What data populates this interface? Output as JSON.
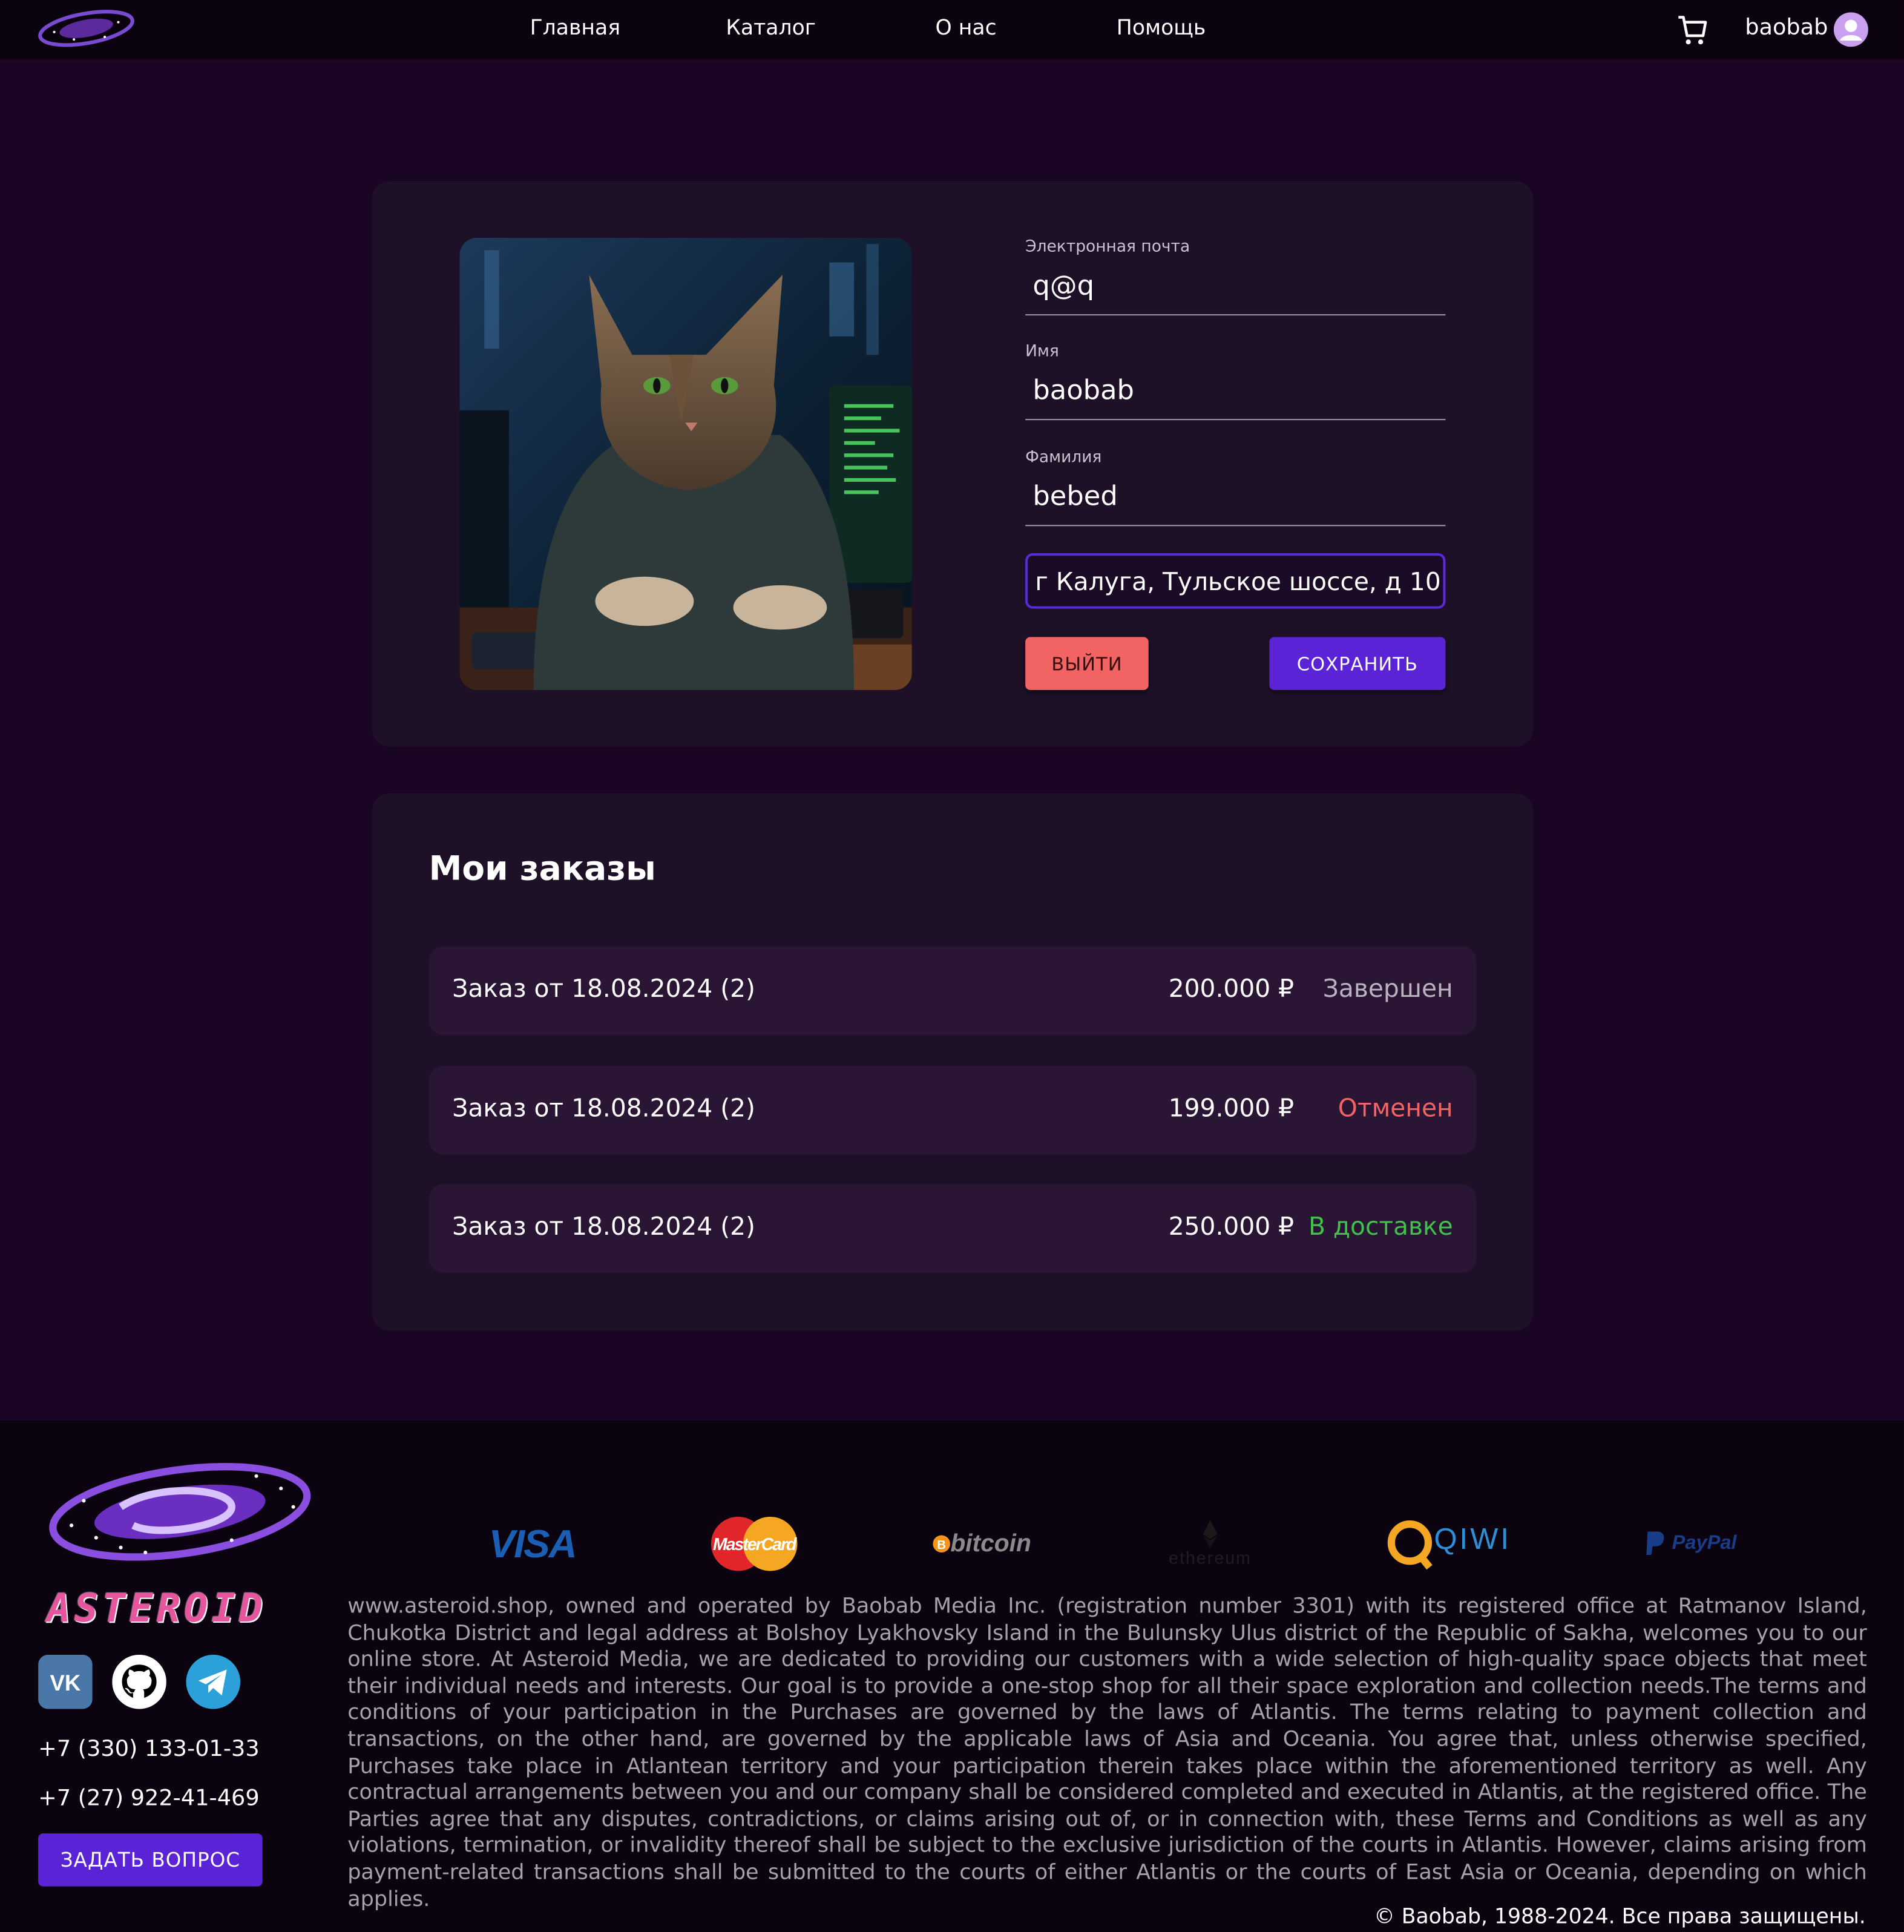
{
  "header": {
    "nav": [
      "Главная",
      "Каталог",
      "О нас",
      "Помощь"
    ],
    "username": "baobab"
  },
  "profile": {
    "email_label": "Электронная почта",
    "email_value": "q@q",
    "name_label": "Имя",
    "name_value": "baobab",
    "surname_label": "Фамилия",
    "surname_value": "bebed",
    "address_value": "г Калуга, Тульское шоссе, д 10",
    "logout_label": "ВЫЙТИ",
    "save_label": "СОХРАНИТЬ"
  },
  "orders": {
    "title": "Мои заказы",
    "items": [
      {
        "title": "Заказ от 18.08.2024 (2)",
        "price": "200.000 ₽",
        "status": "Завершен",
        "status_color": "#b9b2bf"
      },
      {
        "title": "Заказ от 18.08.2024 (2)",
        "price": "199.000 ₽",
        "status": "Отменен",
        "status_color": "#f26464"
      },
      {
        "title": "Заказ от 18.08.2024 (2)",
        "price": "250.000 ₽",
        "status": "В доставке",
        "status_color": "#3fc24a"
      }
    ]
  },
  "footer": {
    "brand": "ASTEROID",
    "phones": [
      "+7 (330) 133-01-33",
      "+7 (27) 922-41-469"
    ],
    "ask_label": "ЗАДАТЬ ВОПРОС",
    "payments": [
      "VISA",
      "MasterCard",
      "bitcoin",
      "ethereum",
      "QIWI",
      "PayPal"
    ],
    "legal": "www.asteroid.shop, owned and operated by Baobab Media Inc. (registration number 3301) with its registered office at Ratmanov Island, Chukotka District and legal address at Bolshoy Lyakhovsky Island in the Bulunsky Ulus district of the Republic of Sakha, welcomes you to our online store. At Asteroid Media, we are dedicated to providing our customers with a wide selection of high-quality space objects that meet their individual needs and interests. Our goal is to provide a one-stop shop for all their space exploration and collection needs.The terms and conditions of your participation in the Purchases are governed by the laws of Atlantis. The terms relating to payment collection and transactions, on the other hand, are governed by the applicable laws of Asia and Oceania. You agree that, unless otherwise specified, Purchases take place in Atlantean territory and your participation therein takes place within the aforementioned territory as well. Any contractual arrangements between you and our company shall be considered completed and executed in Atlantis, at the registered office. The Parties agree that any disputes, contradictions, or claims arising out of, or in connection with, these Terms and Conditions as well as any violations, termination, or invalidity thereof shall be subject to the exclusive jurisdiction of the courts in Atlantis. However, claims arising from payment-related transactions shall be submitted to the courts of either Atlantis or the courts of East Asia or Oceania, depending on which applies.",
    "copyright": "© Baobab, 1988-2024. Все права защищены."
  }
}
